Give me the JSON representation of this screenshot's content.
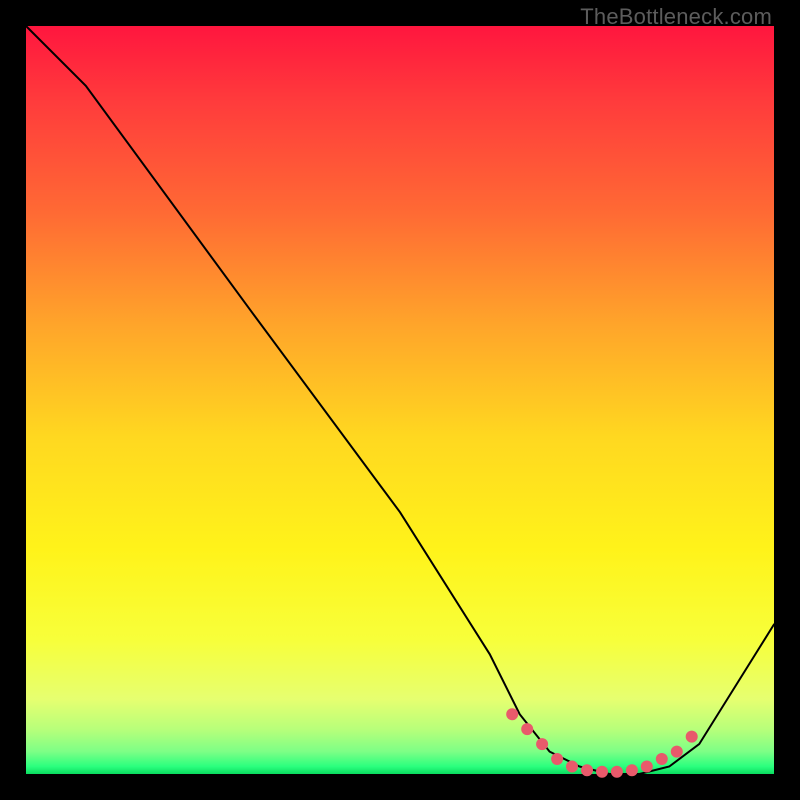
{
  "watermark": "TheBottleneck.com",
  "chart_data": {
    "type": "line",
    "title": "",
    "xlabel": "",
    "ylabel": "",
    "xlim": [
      0,
      100
    ],
    "ylim": [
      0,
      100
    ],
    "series": [
      {
        "name": "bottleneck-curve",
        "x": [
          0,
          8,
          30,
          50,
          62,
          66,
          70,
          74,
          78,
          82,
          86,
          90,
          100
        ],
        "y": [
          100,
          92,
          62,
          35,
          16,
          8,
          3,
          1,
          0,
          0,
          1,
          4,
          20
        ]
      }
    ],
    "optimal_zone": {
      "note": "pink dotted markers near curve minimum",
      "x": [
        65,
        67,
        69,
        71,
        73,
        75,
        77,
        79,
        81,
        83,
        85,
        87,
        89
      ],
      "y": [
        8,
        6,
        4,
        2,
        1,
        0.5,
        0.3,
        0.3,
        0.5,
        1,
        2,
        3,
        5
      ]
    },
    "colors": {
      "gradient_top": "#ff163e",
      "gradient_mid": "#fff31a",
      "gradient_bottom": "#0adc5f",
      "curve": "#000000",
      "dots": "#e85a6b",
      "frame": "#000000"
    }
  }
}
